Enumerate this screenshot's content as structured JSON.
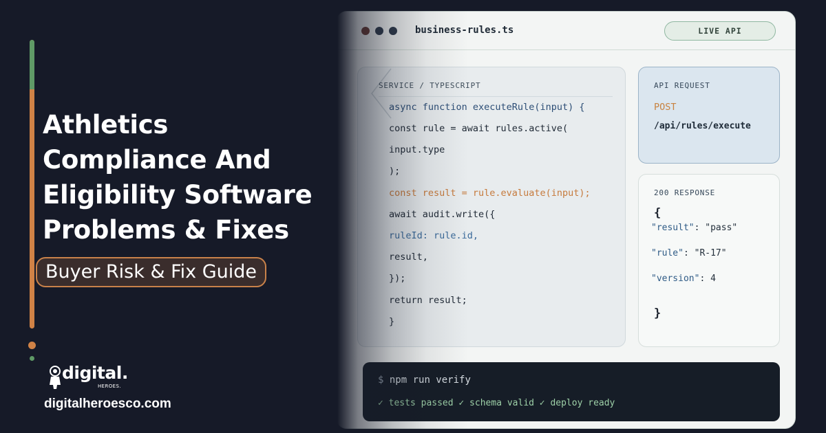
{
  "hero": {
    "title_lines": [
      "Athletics",
      "Compliance And",
      "Eligibility Software",
      "Problems & Fixes"
    ],
    "tagline": "Buyer Risk & Fix Guide"
  },
  "brand": {
    "logo_word": "digital.",
    "logo_sub": "HEROES.",
    "url": "digitalheroesco.com",
    "accent_orange": "#d08246",
    "accent_green": "#5f9a66"
  },
  "editor": {
    "filename": "business-rules.ts",
    "status_pill": "LIVE API",
    "service_label": "SERVICE / TYPESCRIPT",
    "code_lines": [
      "async function executeRule(input) {",
      "const rule = await rules.active(",
      "input.type",
      ");",
      "const result = rule.evaluate(input);",
      "await audit.write({",
      "ruleId: rule.id,",
      "result,",
      "});",
      "return result;",
      "}"
    ],
    "request": {
      "label": "API REQUEST",
      "method": "POST",
      "path": "/api/rules/execute"
    },
    "response": {
      "label": "200 RESPONSE",
      "open_brace": "{",
      "close_brace": "}",
      "lines": [
        {
          "key": "\"result\"",
          "rest": ": \"pass\""
        },
        {
          "key": "\"rule\"",
          "rest": ": \"R-17\""
        },
        {
          "key": "\"version\"",
          "rest": ": 4"
        }
      ]
    },
    "terminal": {
      "prompt": "$",
      "command": "npm run verify",
      "output": "✓ tests passed ✓ schema valid ✓ deploy ready"
    }
  }
}
